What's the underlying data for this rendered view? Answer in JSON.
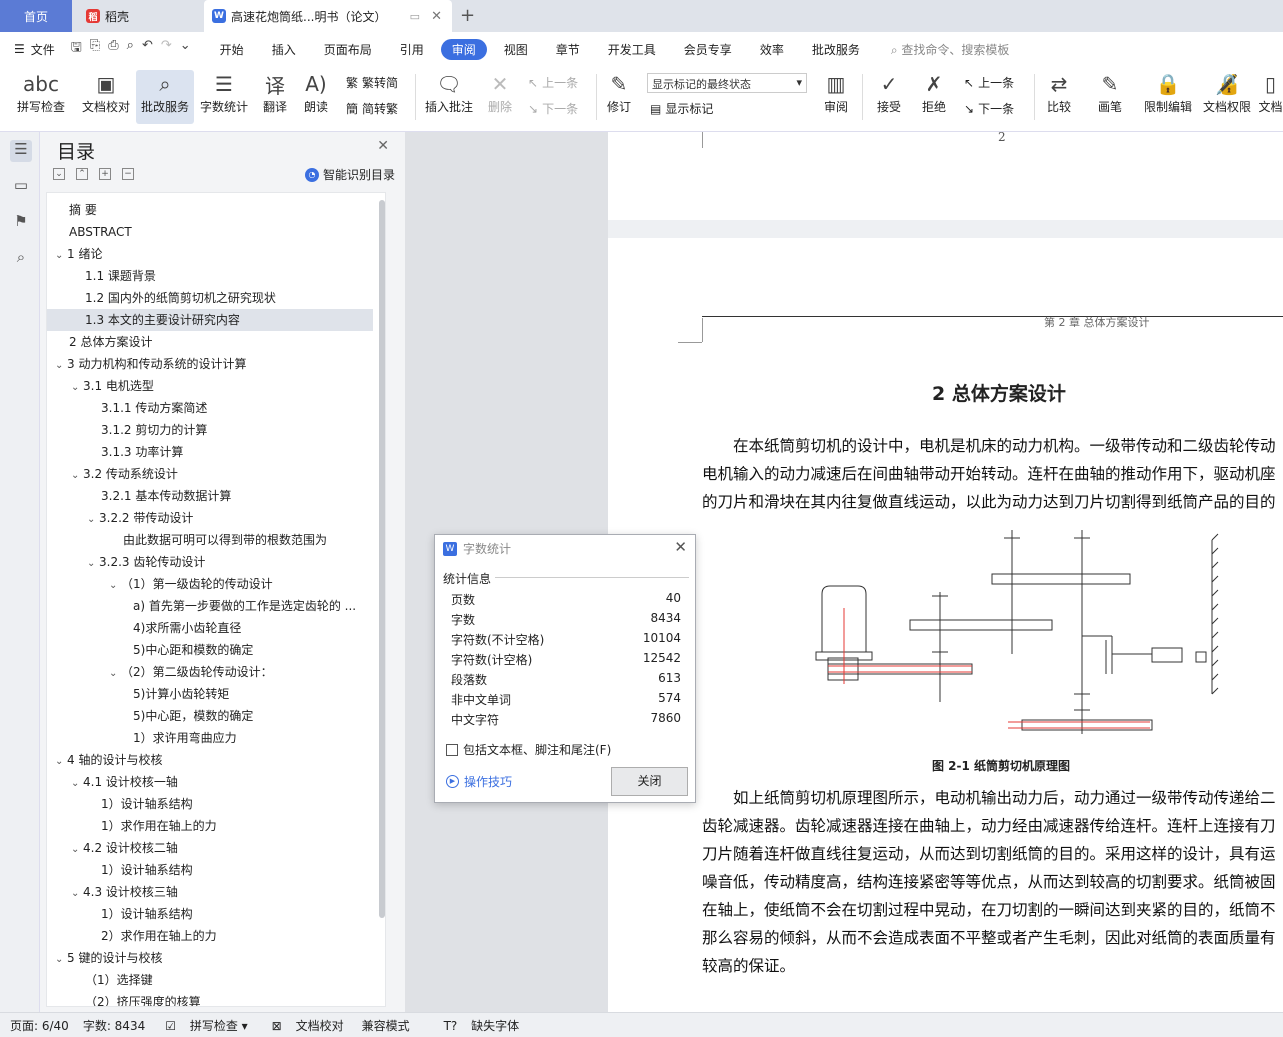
{
  "tabs": {
    "home": "首页",
    "daoke": "稻壳",
    "doc": "高速花炮筒纸...明书（论文）"
  },
  "menu": {
    "file": "文件",
    "tabs": [
      "开始",
      "插入",
      "页面布局",
      "引用",
      "审阅",
      "视图",
      "章节",
      "开发工具",
      "会员专享",
      "效率",
      "批改服务"
    ],
    "active": "审阅",
    "search": "查找命令、搜索模板"
  },
  "ribbon": {
    "spell": "拼写检查",
    "proof": "文档校对",
    "review_service": "批改服务",
    "wordcount": "字数统计",
    "translate": "翻译",
    "read": "朗读",
    "to_trad": "繁转简",
    "to_simp": "简转繁",
    "insert_comment": "插入批注",
    "delete": "删除",
    "prev": "上一条",
    "next": "下一条",
    "revise": "修订",
    "markup_state": "显示标记的最终状态",
    "show_markup": "显示标记",
    "review": "审阅",
    "accept": "接受",
    "reject": "拒绝",
    "prev2": "上一条",
    "next2": "下一条",
    "compare": "比较",
    "pen": "画笔",
    "restrict": "限制编辑",
    "rights": "文档权限",
    "doc_more": "文档"
  },
  "toc": {
    "title": "目录",
    "smart": "智能识别目录",
    "items": [
      {
        "t": "摘  要",
        "l": 0,
        "a": ""
      },
      {
        "t": "ABSTRACT",
        "l": 0,
        "a": ""
      },
      {
        "t": "1    绪论",
        "l": 0,
        "a": "v"
      },
      {
        "t": "1.1 课题背景",
        "l": 1,
        "a": ""
      },
      {
        "t": "1.2  国内外的纸筒剪切机之研究现状",
        "l": 1,
        "a": ""
      },
      {
        "t": "1.3  本文的主要设计研究内容",
        "l": 1,
        "a": "",
        "sel": true
      },
      {
        "t": "2 总体方案设计",
        "l": 0,
        "a": ""
      },
      {
        "t": "3 动力机构和传动系统的设计计算",
        "l": 0,
        "a": "v"
      },
      {
        "t": "3.1  电机选型",
        "l": 1,
        "a": "v"
      },
      {
        "t": "3.1.1 传动方案简述",
        "l": 2,
        "a": ""
      },
      {
        "t": "3.1.2 剪切力的计算",
        "l": 2,
        "a": ""
      },
      {
        "t": "3.1.3 功率计算",
        "l": 2,
        "a": ""
      },
      {
        "t": "3.2 传动系统设计",
        "l": 1,
        "a": "v"
      },
      {
        "t": "3.2.1  基本传动数据计算",
        "l": 2,
        "a": ""
      },
      {
        "t": "3.2.2  带传动设计",
        "l": 2,
        "a": "v"
      },
      {
        "t": "由此数据可明可以得到带的根数范围为",
        "l": 3,
        "a": ""
      },
      {
        "t": "3.2.3    齿轮传动设计",
        "l": 2,
        "a": "v"
      },
      {
        "t": "（1）第一级齿轮的传动设计",
        "l": 3,
        "a": "v"
      },
      {
        "t": "a)  首先第一步要做的工作是选定齿轮的 ...",
        "l": 4,
        "a": ""
      },
      {
        "t": "4)求所需小齿轮直径",
        "l": 4,
        "a": ""
      },
      {
        "t": "5)中心距和模数的确定",
        "l": 4,
        "a": ""
      },
      {
        "t": "（2）第二级齿轮传动设计：",
        "l": 3,
        "a": "v"
      },
      {
        "t": "5)计算小齿轮转矩",
        "l": 4,
        "a": ""
      },
      {
        "t": "5)中心距，模数的确定",
        "l": 4,
        "a": ""
      },
      {
        "t": "1）求许用弯曲应力",
        "l": 4,
        "a": ""
      },
      {
        "t": "4 轴的设计与校核",
        "l": 0,
        "a": "v"
      },
      {
        "t": "4.1    设计校核一轴",
        "l": 1,
        "a": "v"
      },
      {
        "t": "1）设计轴系结构",
        "l": 2,
        "a": ""
      },
      {
        "t": "1）求作用在轴上的力",
        "l": 2,
        "a": ""
      },
      {
        "t": "4.2  设计校核二轴",
        "l": 1,
        "a": "v"
      },
      {
        "t": "1）设计轴系结构",
        "l": 2,
        "a": ""
      },
      {
        "t": "4.3    设计校核三轴",
        "l": 1,
        "a": "v"
      },
      {
        "t": "1）设计轴系结构",
        "l": 2,
        "a": ""
      },
      {
        "t": "2）求作用在轴上的力",
        "l": 2,
        "a": ""
      },
      {
        "t": "5 键的设计与校核",
        "l": 0,
        "a": "v"
      },
      {
        "t": "（1）选择键",
        "l": 1,
        "a": ""
      },
      {
        "t": "（2）挤压强度的核算",
        "l": 1,
        "a": ""
      }
    ]
  },
  "doc": {
    "page_num": "2",
    "header": "第 2 章  总体方案设计",
    "heading": "2 总体方案设计",
    "para1": [
      "　　在本纸筒剪切机的设计中，电机是机床的动力机构。一级带传动和二级齿轮传动",
      "电机输入的动力减速后在间曲轴带动开始转动。连杆在曲轴的推动作用下，驱动机座",
      "的刀片和滑块在其内往复做直线运动，以此为动力达到刀片切割得到纸筒产品的目的"
    ],
    "figure_caption": "图 2-1    纸筒剪切机原理图",
    "para2": [
      "　　如上纸筒剪切机原理图所示，电动机输出动力后，动力通过一级带传动传递给二",
      "齿轮减速器。齿轮减速器连接在曲轴上，动力经由减速器传给连杆。连杆上连接有刀",
      "刀片随着连杆做直线往复运动，从而达到切割纸筒的目的。采用这样的设计，具有运",
      "噪音低，传动精度高，结构连接紧密等等优点，从而达到较高的切割要求。纸筒被固",
      "在轴上，使纸筒不会在切割过程中晃动，在刀切割的一瞬间达到夹紧的目的，纸筒不",
      "那么容易的倾斜，从而不会造成表面不平整或者产生毛刺，因此对纸筒的表面质量有",
      "较高的保证。"
    ]
  },
  "dialog": {
    "title": "字数统计",
    "section": "统计信息",
    "stats": [
      {
        "k": "页数",
        "v": "40"
      },
      {
        "k": "字数",
        "v": "8434"
      },
      {
        "k": "字符数(不计空格)",
        "v": "10104"
      },
      {
        "k": "字符数(计空格)",
        "v": "12542"
      },
      {
        "k": "段落数",
        "v": "613"
      },
      {
        "k": "非中文单词",
        "v": "574"
      },
      {
        "k": "中文字符",
        "v": "7860"
      }
    ],
    "checkbox": "包括文本框、脚注和尾注(F)",
    "tips": "操作技巧",
    "close": "关闭"
  },
  "status": {
    "page": "页面: 6/40",
    "words": "字数: 8434",
    "spell": "拼写检查",
    "proof": "文档校对",
    "compat": "兼容模式",
    "missing_font": "缺失字体"
  },
  "colors": {
    "accent": "#3b6fe0",
    "home_tab": "#5b7bd5",
    "red_line": "#e53935"
  }
}
